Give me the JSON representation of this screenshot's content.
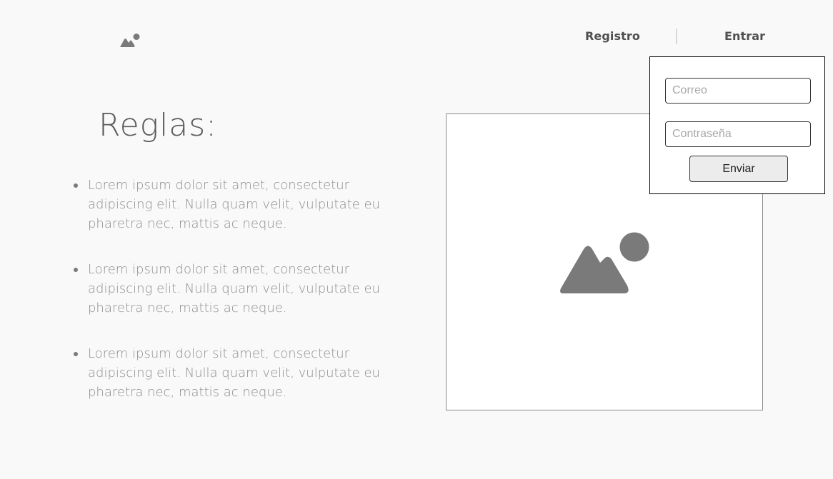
{
  "header": {
    "logo_icon": "image-icon",
    "nav": {
      "register_label": "Registro",
      "login_label": "Entrar"
    }
  },
  "main": {
    "title": "Reglas:",
    "rules": [
      "Lorem ipsum dolor sit amet, consectetur adipiscing elit. Nulla quam velit, vulputate eu pharetra nec, mattis ac neque.",
      "Lorem ipsum dolor sit amet, consectetur adipiscing elit. Nulla quam velit, vulputate eu pharetra nec, mattis ac neque.",
      "Lorem ipsum dolor sit amet, consectetur adipiscing elit. Nulla quam velit, vulputate eu pharetra nec, mattis ac neque."
    ],
    "image_placeholder_icon": "image-icon"
  },
  "login_form": {
    "email_placeholder": "Correo",
    "email_value": "",
    "password_placeholder": "Contraseña",
    "password_value": "",
    "submit_label": "Enviar"
  },
  "colors": {
    "background": "#f9f9f9",
    "text_dark": "#4f4f4f",
    "text_muted": "#8e8e8e",
    "icon_gray": "#7a7a7a"
  }
}
